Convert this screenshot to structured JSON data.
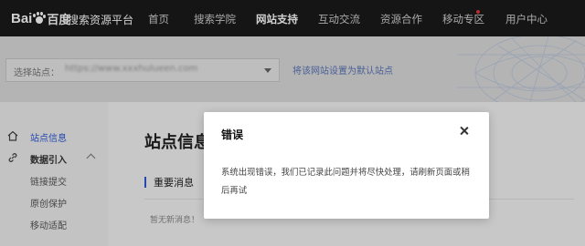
{
  "topbar": {
    "logo_bai": "Bai",
    "logo_cn": "百度",
    "platform": "搜索资源平台",
    "nav": [
      {
        "label": "首页"
      },
      {
        "label": "搜索学院"
      },
      {
        "label": "网站支持"
      },
      {
        "label": "互动交流"
      },
      {
        "label": "资源合作"
      },
      {
        "label": "移动专区"
      },
      {
        "label": "用户中心"
      }
    ],
    "active_nav": "网站支持"
  },
  "site_select": {
    "label": "选择站点：",
    "value": "https://www.xxxhulueen.com",
    "set_default_link": "将该网站设置为默认站点"
  },
  "sidebar": {
    "items": [
      {
        "label": "站点信息",
        "icon": "home-icon"
      },
      {
        "label": "数据引入",
        "icon": "link-icon"
      },
      {
        "label": "链接提交"
      },
      {
        "label": "原创保护"
      },
      {
        "label": "移动适配"
      }
    ]
  },
  "main": {
    "title": "站点信息",
    "section_title": "重要消息",
    "empty_text": "暂无新消息！"
  },
  "dialog": {
    "title": "错误",
    "message": "系统出现错误，我们已记录此问题并将尽快处理，请刷新页面或稍后再试"
  },
  "colors": {
    "topbar_bg": "#1a1a1a",
    "accent_blue": "#2f57d8",
    "link_blue": "#5a74b8"
  }
}
